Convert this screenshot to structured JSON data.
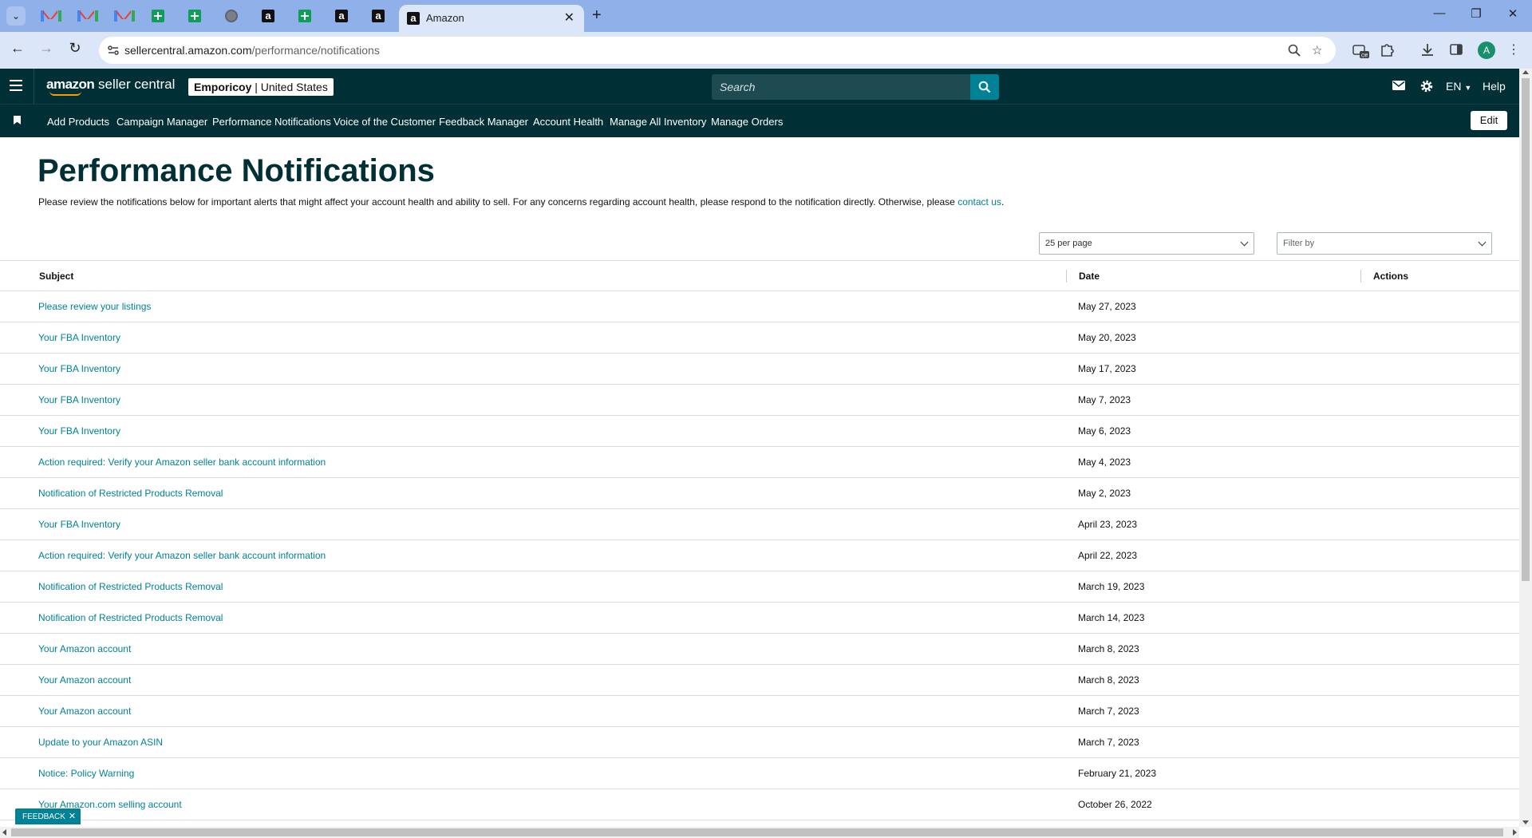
{
  "browser": {
    "active_tab_title": "Amazon",
    "url_domain": "sellercentral.amazon.com",
    "url_path": "/performance/notifications",
    "avatar_letter": "A",
    "extension_badge": "Off"
  },
  "header": {
    "logo_brand": "amazon",
    "logo_suffix": " seller central",
    "store_name": "Emporicoy",
    "store_region": " | United States",
    "search_placeholder": "Search",
    "language": "EN",
    "help": "Help"
  },
  "nav": {
    "links": [
      "Add Products",
      "Campaign Manager",
      "Performance Notifications",
      "Voice of the Customer",
      "Feedback Manager",
      "Account Health",
      "Manage All Inventory",
      "Manage Orders"
    ],
    "edit_label": "Edit"
  },
  "main": {
    "title": "Performance Notifications",
    "intro": "Please review the notifications below for important alerts that might affect your account health and ability to sell. For any concerns regarding account health, please respond to the notification directly. Otherwise, please ",
    "intro_link": "contact us",
    "intro_end": ".",
    "per_page_value": "25 per page",
    "filter_placeholder": "Filter by"
  },
  "table": {
    "columns": [
      "Subject",
      "Date",
      "Actions"
    ],
    "rows": [
      {
        "subject": "Please review your listings",
        "date": "May 27, 2023"
      },
      {
        "subject": "Your FBA Inventory",
        "date": "May 20, 2023"
      },
      {
        "subject": "Your FBA Inventory",
        "date": "May 17, 2023"
      },
      {
        "subject": "Your FBA Inventory",
        "date": "May 7, 2023"
      },
      {
        "subject": "Your FBA Inventory",
        "date": "May 6, 2023"
      },
      {
        "subject": "Action required: Verify your Amazon seller bank account information",
        "date": "May 4, 2023"
      },
      {
        "subject": "Notification of Restricted Products Removal",
        "date": "May 2, 2023"
      },
      {
        "subject": "Your FBA Inventory",
        "date": "April 23, 2023"
      },
      {
        "subject": "Action required: Verify your Amazon seller bank account information",
        "date": "April 22, 2023"
      },
      {
        "subject": "Notification of Restricted Products Removal",
        "date": "March 19, 2023"
      },
      {
        "subject": "Notification of Restricted Products Removal",
        "date": "March 14, 2023"
      },
      {
        "subject": "Your Amazon account",
        "date": "March 8, 2023"
      },
      {
        "subject": "Your Amazon account",
        "date": "March 8, 2023"
      },
      {
        "subject": "Your Amazon account",
        "date": "March 7, 2023"
      },
      {
        "subject": "Update to your Amazon ASIN",
        "date": "March 7, 2023"
      },
      {
        "subject": "Notice: Policy Warning",
        "date": "February 21, 2023"
      },
      {
        "subject": "Your Amazon.com selling account",
        "date": "October 26, 2022"
      }
    ]
  },
  "feedback_label": "FEEDBACK",
  "colors": {
    "header_bg": "#002f36",
    "accent": "#008296",
    "tab_strip": "#8fb0e8",
    "toolbar": "#dbe6f8"
  }
}
